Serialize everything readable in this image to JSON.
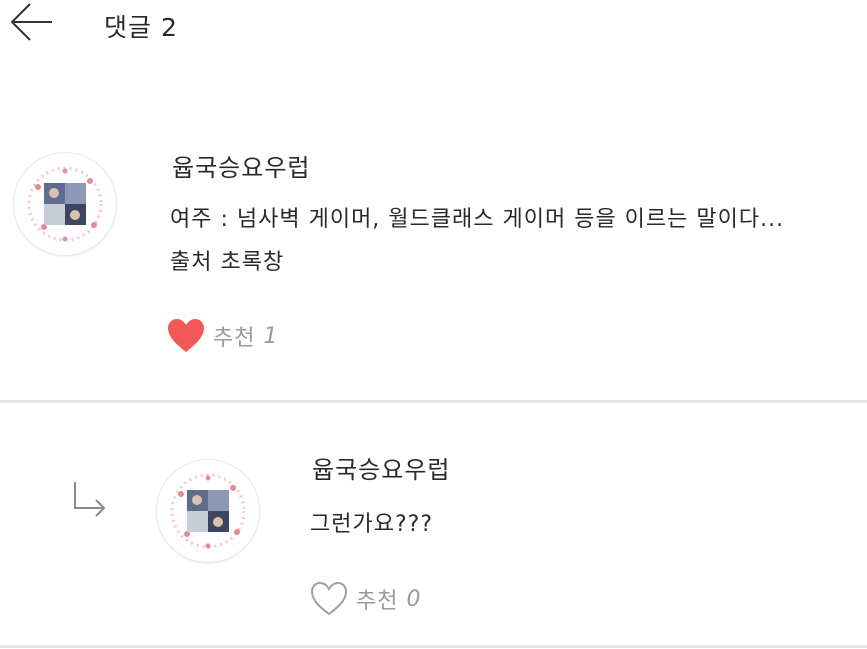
{
  "header": {
    "title": "댓글 2"
  },
  "comments": [
    {
      "author": "윱국승요우럽",
      "lines": [
        "여주 : 넘사벽 게이머, 월드클래스 게이머 등을 이르는 말이다...",
        "출처 초록창"
      ],
      "like_label": "추천",
      "like_count": "1",
      "liked": true
    },
    {
      "author": "윱국승요우럽",
      "lines": [
        "그런가요???"
      ],
      "like_label": "추천",
      "like_count": "0",
      "liked": false
    }
  ],
  "colors": {
    "heart_filled": "#f25858",
    "heart_outline": "#a0a0a0",
    "divider": "#e6e6e6",
    "muted_text": "#9a9a9a"
  },
  "icons": {
    "back": "arrow-left-icon",
    "reply": "reply-arrow-icon",
    "like_filled": "heart-filled-icon",
    "like_outline": "heart-outline-icon"
  }
}
